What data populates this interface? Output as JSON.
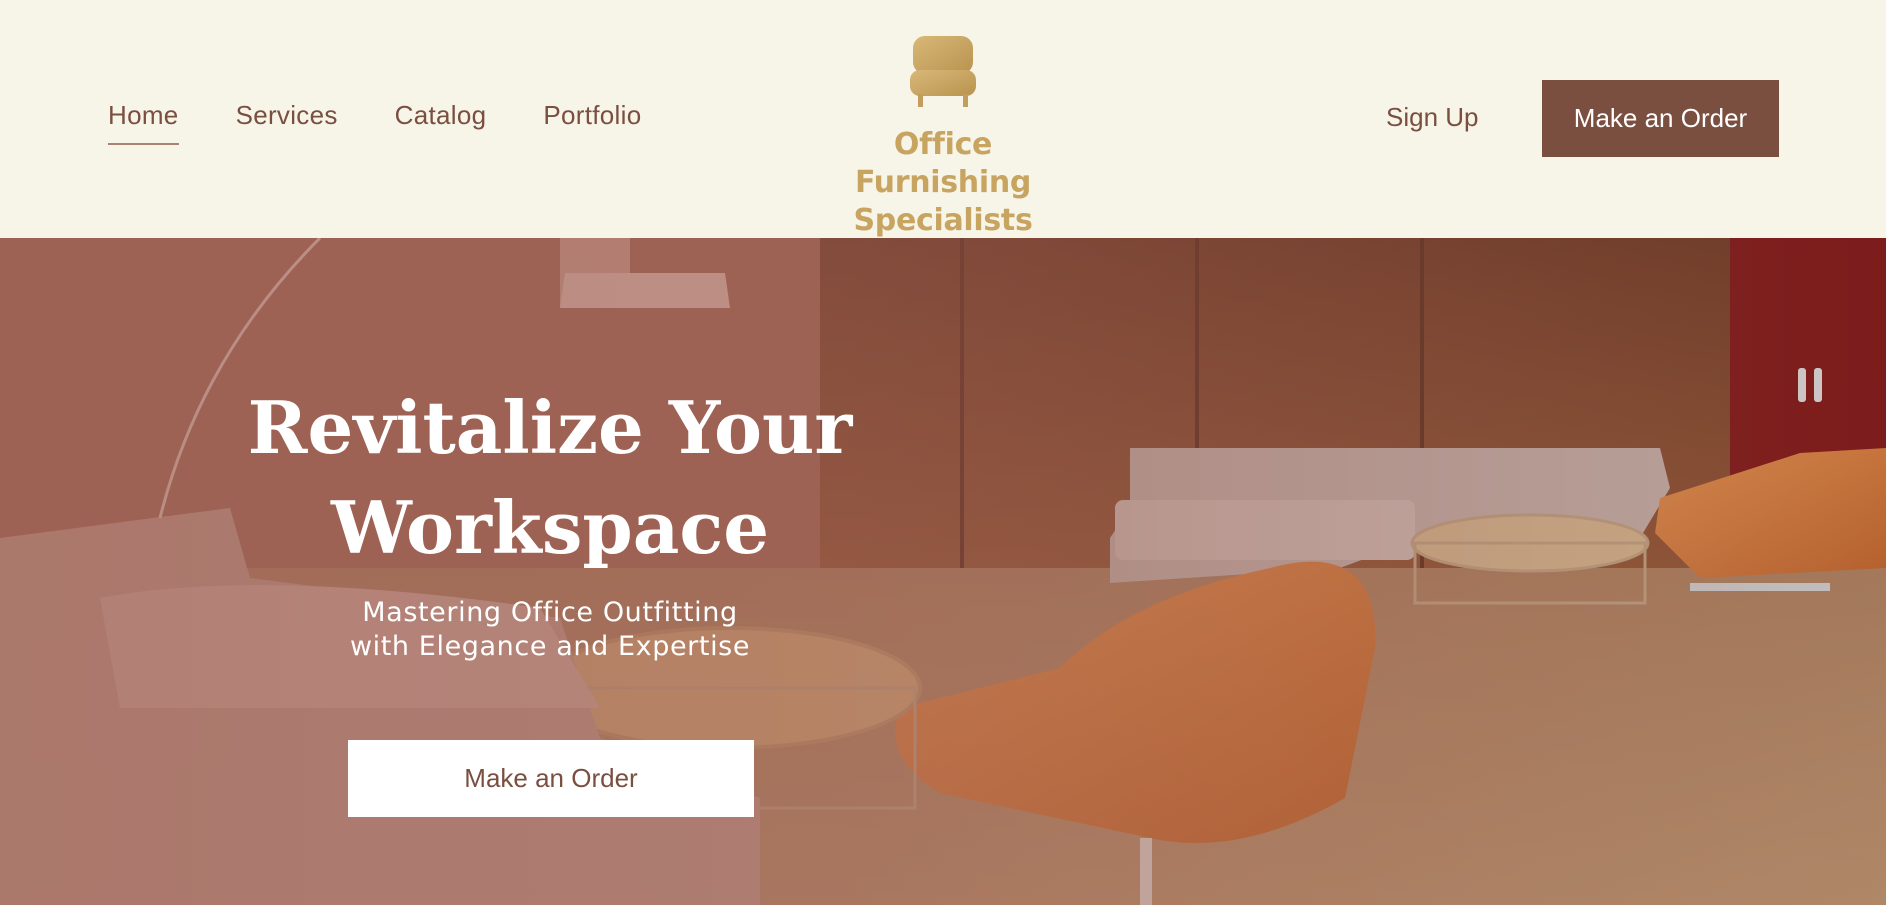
{
  "nav": {
    "items": [
      {
        "label": "Home",
        "active": true
      },
      {
        "label": "Services",
        "active": false
      },
      {
        "label": "Catalog",
        "active": false
      },
      {
        "label": "Portfolio",
        "active": false
      }
    ]
  },
  "logo": {
    "line1": "Office Furnishing",
    "line2": "Specialists",
    "icon": "armchair-icon",
    "color": "#c8a461"
  },
  "header_actions": {
    "signup_label": "Sign Up",
    "order_label": "Make an Order"
  },
  "hero": {
    "title_line1": "Revitalize Your",
    "title_line2": "Workspace",
    "subtitle_line1": "Mastering Office Outfitting",
    "subtitle_line2": "with Elegance and Expertise",
    "cta_label": "Make an Order"
  },
  "colors": {
    "background": "#f7f4e8",
    "brand_brown": "#7b4f40",
    "gold": "#c8a461"
  }
}
